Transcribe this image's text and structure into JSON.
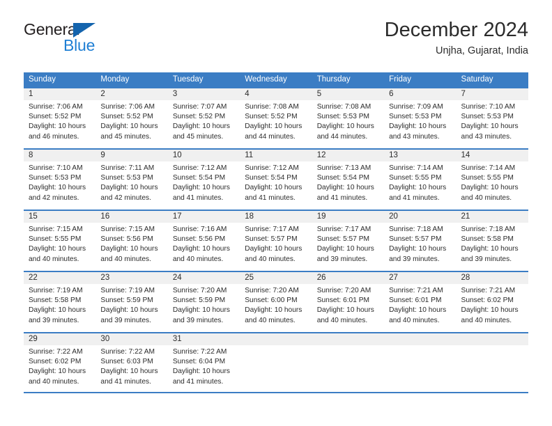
{
  "brand": {
    "name_top": "General",
    "name_bottom": "Blue",
    "triangle_color": "#1464ad",
    "blue_color": "#1f7fd4"
  },
  "header": {
    "title": "December 2024",
    "subtitle": "Unjha, Gujarat, India"
  },
  "theme": {
    "header_blue": "#3b7dc4",
    "daynum_background": "#f0f0f0",
    "text_color": "#2b2b2b"
  },
  "weekdays": [
    "Sunday",
    "Monday",
    "Tuesday",
    "Wednesday",
    "Thursday",
    "Friday",
    "Saturday"
  ],
  "weeks": [
    [
      {
        "day": "1",
        "sunrise": "Sunrise: 7:06 AM",
        "sunset": "Sunset: 5:52 PM",
        "daylight1": "Daylight: 10 hours",
        "daylight2": "and 46 minutes."
      },
      {
        "day": "2",
        "sunrise": "Sunrise: 7:06 AM",
        "sunset": "Sunset: 5:52 PM",
        "daylight1": "Daylight: 10 hours",
        "daylight2": "and 45 minutes."
      },
      {
        "day": "3",
        "sunrise": "Sunrise: 7:07 AM",
        "sunset": "Sunset: 5:52 PM",
        "daylight1": "Daylight: 10 hours",
        "daylight2": "and 45 minutes."
      },
      {
        "day": "4",
        "sunrise": "Sunrise: 7:08 AM",
        "sunset": "Sunset: 5:52 PM",
        "daylight1": "Daylight: 10 hours",
        "daylight2": "and 44 minutes."
      },
      {
        "day": "5",
        "sunrise": "Sunrise: 7:08 AM",
        "sunset": "Sunset: 5:53 PM",
        "daylight1": "Daylight: 10 hours",
        "daylight2": "and 44 minutes."
      },
      {
        "day": "6",
        "sunrise": "Sunrise: 7:09 AM",
        "sunset": "Sunset: 5:53 PM",
        "daylight1": "Daylight: 10 hours",
        "daylight2": "and 43 minutes."
      },
      {
        "day": "7",
        "sunrise": "Sunrise: 7:10 AM",
        "sunset": "Sunset: 5:53 PM",
        "daylight1": "Daylight: 10 hours",
        "daylight2": "and 43 minutes."
      }
    ],
    [
      {
        "day": "8",
        "sunrise": "Sunrise: 7:10 AM",
        "sunset": "Sunset: 5:53 PM",
        "daylight1": "Daylight: 10 hours",
        "daylight2": "and 42 minutes."
      },
      {
        "day": "9",
        "sunrise": "Sunrise: 7:11 AM",
        "sunset": "Sunset: 5:53 PM",
        "daylight1": "Daylight: 10 hours",
        "daylight2": "and 42 minutes."
      },
      {
        "day": "10",
        "sunrise": "Sunrise: 7:12 AM",
        "sunset": "Sunset: 5:54 PM",
        "daylight1": "Daylight: 10 hours",
        "daylight2": "and 41 minutes."
      },
      {
        "day": "11",
        "sunrise": "Sunrise: 7:12 AM",
        "sunset": "Sunset: 5:54 PM",
        "daylight1": "Daylight: 10 hours",
        "daylight2": "and 41 minutes."
      },
      {
        "day": "12",
        "sunrise": "Sunrise: 7:13 AM",
        "sunset": "Sunset: 5:54 PM",
        "daylight1": "Daylight: 10 hours",
        "daylight2": "and 41 minutes."
      },
      {
        "day": "13",
        "sunrise": "Sunrise: 7:14 AM",
        "sunset": "Sunset: 5:55 PM",
        "daylight1": "Daylight: 10 hours",
        "daylight2": "and 41 minutes."
      },
      {
        "day": "14",
        "sunrise": "Sunrise: 7:14 AM",
        "sunset": "Sunset: 5:55 PM",
        "daylight1": "Daylight: 10 hours",
        "daylight2": "and 40 minutes."
      }
    ],
    [
      {
        "day": "15",
        "sunrise": "Sunrise: 7:15 AM",
        "sunset": "Sunset: 5:55 PM",
        "daylight1": "Daylight: 10 hours",
        "daylight2": "and 40 minutes."
      },
      {
        "day": "16",
        "sunrise": "Sunrise: 7:15 AM",
        "sunset": "Sunset: 5:56 PM",
        "daylight1": "Daylight: 10 hours",
        "daylight2": "and 40 minutes."
      },
      {
        "day": "17",
        "sunrise": "Sunrise: 7:16 AM",
        "sunset": "Sunset: 5:56 PM",
        "daylight1": "Daylight: 10 hours",
        "daylight2": "and 40 minutes."
      },
      {
        "day": "18",
        "sunrise": "Sunrise: 7:17 AM",
        "sunset": "Sunset: 5:57 PM",
        "daylight1": "Daylight: 10 hours",
        "daylight2": "and 40 minutes."
      },
      {
        "day": "19",
        "sunrise": "Sunrise: 7:17 AM",
        "sunset": "Sunset: 5:57 PM",
        "daylight1": "Daylight: 10 hours",
        "daylight2": "and 39 minutes."
      },
      {
        "day": "20",
        "sunrise": "Sunrise: 7:18 AM",
        "sunset": "Sunset: 5:57 PM",
        "daylight1": "Daylight: 10 hours",
        "daylight2": "and 39 minutes."
      },
      {
        "day": "21",
        "sunrise": "Sunrise: 7:18 AM",
        "sunset": "Sunset: 5:58 PM",
        "daylight1": "Daylight: 10 hours",
        "daylight2": "and 39 minutes."
      }
    ],
    [
      {
        "day": "22",
        "sunrise": "Sunrise: 7:19 AM",
        "sunset": "Sunset: 5:58 PM",
        "daylight1": "Daylight: 10 hours",
        "daylight2": "and 39 minutes."
      },
      {
        "day": "23",
        "sunrise": "Sunrise: 7:19 AM",
        "sunset": "Sunset: 5:59 PM",
        "daylight1": "Daylight: 10 hours",
        "daylight2": "and 39 minutes."
      },
      {
        "day": "24",
        "sunrise": "Sunrise: 7:20 AM",
        "sunset": "Sunset: 5:59 PM",
        "daylight1": "Daylight: 10 hours",
        "daylight2": "and 39 minutes."
      },
      {
        "day": "25",
        "sunrise": "Sunrise: 7:20 AM",
        "sunset": "Sunset: 6:00 PM",
        "daylight1": "Daylight: 10 hours",
        "daylight2": "and 40 minutes."
      },
      {
        "day": "26",
        "sunrise": "Sunrise: 7:20 AM",
        "sunset": "Sunset: 6:01 PM",
        "daylight1": "Daylight: 10 hours",
        "daylight2": "and 40 minutes."
      },
      {
        "day": "27",
        "sunrise": "Sunrise: 7:21 AM",
        "sunset": "Sunset: 6:01 PM",
        "daylight1": "Daylight: 10 hours",
        "daylight2": "and 40 minutes."
      },
      {
        "day": "28",
        "sunrise": "Sunrise: 7:21 AM",
        "sunset": "Sunset: 6:02 PM",
        "daylight1": "Daylight: 10 hours",
        "daylight2": "and 40 minutes."
      }
    ],
    [
      {
        "day": "29",
        "sunrise": "Sunrise: 7:22 AM",
        "sunset": "Sunset: 6:02 PM",
        "daylight1": "Daylight: 10 hours",
        "daylight2": "and 40 minutes."
      },
      {
        "day": "30",
        "sunrise": "Sunrise: 7:22 AM",
        "sunset": "Sunset: 6:03 PM",
        "daylight1": "Daylight: 10 hours",
        "daylight2": "and 41 minutes."
      },
      {
        "day": "31",
        "sunrise": "Sunrise: 7:22 AM",
        "sunset": "Sunset: 6:04 PM",
        "daylight1": "Daylight: 10 hours",
        "daylight2": "and 41 minutes."
      },
      {
        "day": "",
        "sunrise": "",
        "sunset": "",
        "daylight1": "",
        "daylight2": ""
      },
      {
        "day": "",
        "sunrise": "",
        "sunset": "",
        "daylight1": "",
        "daylight2": ""
      },
      {
        "day": "",
        "sunrise": "",
        "sunset": "",
        "daylight1": "",
        "daylight2": ""
      },
      {
        "day": "",
        "sunrise": "",
        "sunset": "",
        "daylight1": "",
        "daylight2": ""
      }
    ]
  ]
}
